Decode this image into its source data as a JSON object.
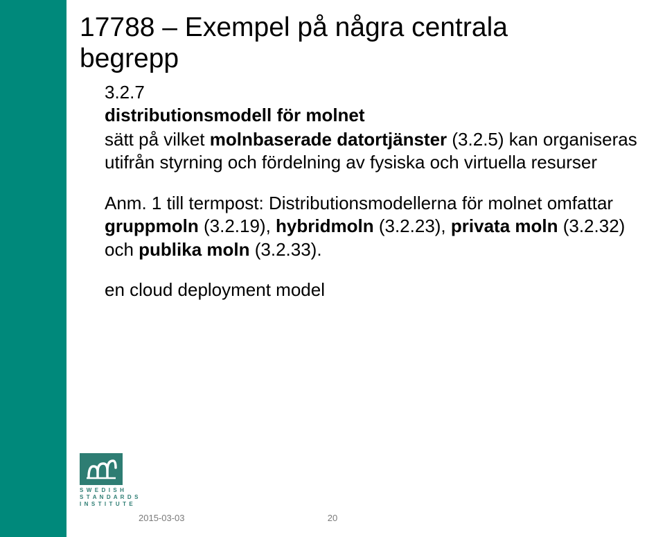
{
  "title_line1": "17788 – Exempel på några centrala",
  "title_line2": "begrepp",
  "section_number": "3.2.7",
  "term": "distributionsmodell för molnet",
  "definition_part1": "sätt på vilket  ",
  "definition_bold1": "molnbaserade datortjänster",
  "definition_part2": " (3.2.5) kan organiseras utifrån styrning och fördelning av fysiska och virtuella resurser",
  "note_prefix": "Anm. 1 till termpost: Distributionsmodellerna för molnet omfattar ",
  "note_bold1": "gruppmoln",
  "note_part1": " (3.2.19), ",
  "note_bold2": "hybridmoln",
  "note_part2": " (3.2.23), ",
  "note_bold3": "privata moln",
  "note_part3": " (3.2.32) och ",
  "note_bold4": "publika moln",
  "note_part4": " (3.2.33).",
  "english_term": "en cloud deployment model",
  "logo_text_line1": "S W E D I S H",
  "logo_text_line2": "S T A N D A R D S",
  "logo_text_line3": "I N S T I T U T E",
  "footer_date": "2015-03-03",
  "footer_page": "20"
}
